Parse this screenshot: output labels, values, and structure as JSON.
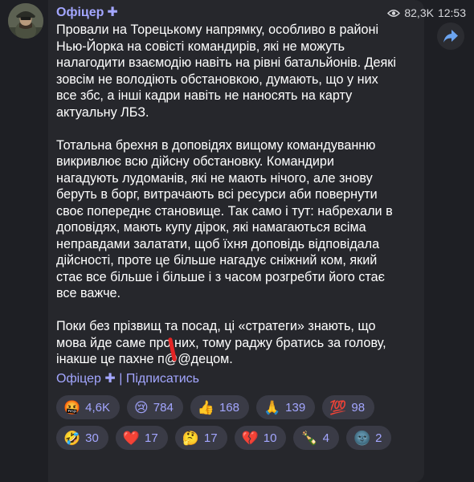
{
  "channel": {
    "name": "Офіцер",
    "badge": "✚",
    "views": "82,3K",
    "time": "12:53"
  },
  "post": {
    "paragraphs": [
      "Провали на Торецькому напрямку, особливо в районі\nНью-Йорка на совісті командирів, які не можуть\nналагодити взаємодію навіть на рівні батальйонів. Деякі\nзовсім не володіють обстановкою, думають, що у них\nвсе збс, а інші кадри навіть не наносять на карту\nактуальну ЛБЗ.",
      "Тотальна брехня в доповідях вищому командуванню\nвикривлює всю дійсну обстановку. Командири\nнагадують лудоманів, які не мають нічого, але знову\nберуть в борг, витрачають всі ресурси аби повернути\nсвоє попереднє становище. Так само і тут: набрехали в\nдоповідях, мають купу дірок, які намагаються всіма\nнеправдами залатати, щоб їхня доповідь відповідала\nдійсності, проте це більше нагадує сніжний ком, який\nстає все більше і більше і з часом розгребти його стає\nвсе важче.",
      "Поки без прізвищ та посад, ці «стратеги» знають, що\nмова йде саме про них, тому раджу братись за голову,\nінакше це пахне п@@децом."
    ]
  },
  "signature": {
    "name": "Офіцер",
    "badge": "✚",
    "separator": "|",
    "subscribe": "Підписатись"
  },
  "reactions": [
    {
      "emoji": "🤬",
      "count": "4,6K"
    },
    {
      "emoji": "😢",
      "count": "784"
    },
    {
      "emoji": "👍",
      "count": "168"
    },
    {
      "emoji": "🙏",
      "count": "139"
    },
    {
      "emoji": "💯",
      "count": "98"
    },
    {
      "emoji": "🤣",
      "count": "30"
    },
    {
      "emoji": "❤️",
      "count": "17"
    },
    {
      "emoji": "🤔",
      "count": "17"
    },
    {
      "emoji": "💔",
      "count": "10"
    },
    {
      "emoji": "🍾",
      "count": "4"
    },
    {
      "emoji": "🌚",
      "count": "2"
    }
  ],
  "colors": {
    "background": "#1e1f24",
    "bubble": "#26272c",
    "accent": "#a3a6ff",
    "reaction_bg": "#3a3b46",
    "annotation": "#e32525"
  },
  "icons": [
    "views-eye-icon",
    "share-arrow-icon",
    "channel-avatar"
  ]
}
